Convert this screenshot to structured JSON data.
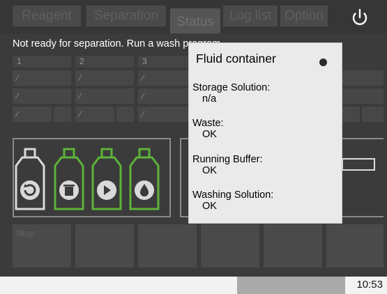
{
  "tabs": [
    {
      "label": "Reagent"
    },
    {
      "label": "Separation"
    },
    {
      "label": "Status"
    },
    {
      "label": "Log list"
    },
    {
      "label": "Option"
    }
  ],
  "status_message": "Not ready for separation. Run a wash program",
  "grid": {
    "headers": [
      "1",
      "2",
      "3"
    ]
  },
  "bottom_buttons": {
    "stop_label": "Stop"
  },
  "popup": {
    "title": "Fluid container",
    "items": [
      {
        "label": "Storage Solution:",
        "value": "n/a"
      },
      {
        "label": "Waste:",
        "value": "OK"
      },
      {
        "label": "Running Buffer:",
        "value": "OK"
      },
      {
        "label": "Washing Solution:",
        "value": "OK"
      }
    ]
  },
  "footer": {
    "clock": "10:53"
  },
  "colors": {
    "bottle_inactive": "#d9d9d9",
    "bottle_active": "#5db33a"
  },
  "icons": {
    "power": "power-icon",
    "bottles": [
      "refresh-icon",
      "trash-icon",
      "play-icon",
      "drop-icon"
    ]
  }
}
